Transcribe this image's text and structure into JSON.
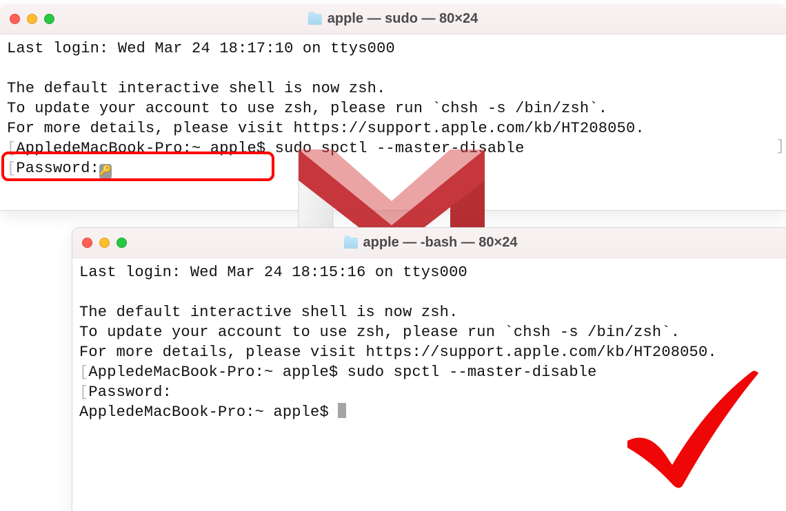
{
  "window1": {
    "title": "apple — sudo — 80×24",
    "lines": {
      "last_login": "Last login: Wed Mar 24 18:17:10 on ttys000",
      "zsh_notice": "The default interactive shell is now zsh.",
      "zsh_update": "To update your account to use zsh, please run `chsh -s /bin/zsh`.",
      "zsh_details": "For more details, please visit https://support.apple.com/kb/HT208050.",
      "prompt_cmd": "AppledeMacBook-Pro:~ apple$ sudo spctl --master-disable",
      "password_label": "Password:"
    }
  },
  "window2": {
    "title": "apple — -bash — 80×24",
    "lines": {
      "last_login": "Last login: Wed Mar 24 18:15:16 on ttys000",
      "zsh_notice": "The default interactive shell is now zsh.",
      "zsh_update": "To update your account to use zsh, please run `chsh -s /bin/zsh`.",
      "zsh_details": "For more details, please visit https://support.apple.com/kb/HT208050.",
      "prompt_cmd": "AppledeMacBook-Pro:~ apple$ sudo spctl --master-disable",
      "password_label": "Password:",
      "prompt_ready": "AppledeMacBook-Pro:~ apple$ "
    }
  },
  "icons": {
    "folder": "folder-icon",
    "key": "key-icon",
    "m_logo": "gmail-m-logo",
    "check": "red-checkmark"
  },
  "colors": {
    "highlight_border": "#ff0000",
    "logo_red": "#c1272d",
    "check_red": "#ef0707"
  }
}
